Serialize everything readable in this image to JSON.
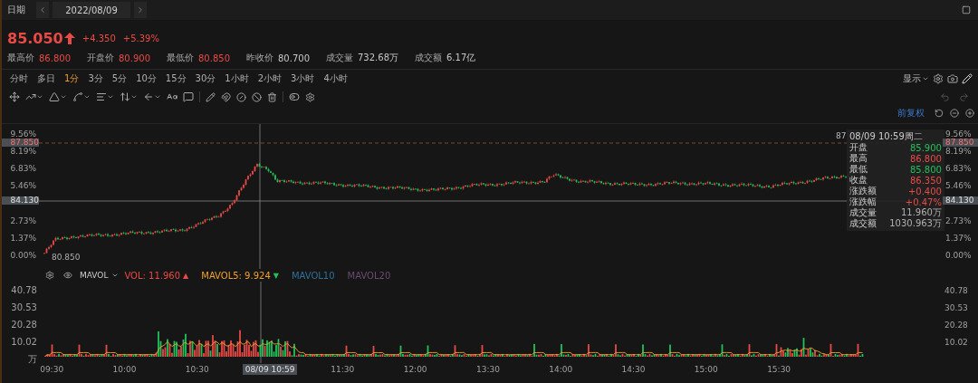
{
  "date_bar": {
    "label": "日期",
    "date": "2022/08/09"
  },
  "quote": {
    "price": "85.050",
    "change": "+4.350",
    "change_pct": "+5.39%",
    "stats": [
      {
        "label": "最高价",
        "value": "86.800",
        "color": "#e84a46"
      },
      {
        "label": "开盘价",
        "value": "80.900",
        "color": "#e84a46"
      },
      {
        "label": "最低价",
        "value": "80.850",
        "color": "#e84a46"
      },
      {
        "label": "昨收价",
        "value": "80.700",
        "color": "#c8c8c8"
      },
      {
        "label": "成交量",
        "value": "732.68万",
        "color": "#c8c8c8"
      },
      {
        "label": "成交额",
        "value": "6.17亿",
        "color": "#c8c8c8"
      }
    ]
  },
  "periods": [
    {
      "label": "分时",
      "selected": false
    },
    {
      "label": "多日",
      "selected": false
    },
    {
      "label": "1分",
      "selected": true
    },
    {
      "label": "3分",
      "selected": false
    },
    {
      "label": "5分",
      "selected": false
    },
    {
      "label": "10分",
      "selected": false
    },
    {
      "label": "15分",
      "selected": false
    },
    {
      "label": "30分",
      "selected": false
    },
    {
      "label": "1小时",
      "selected": false
    },
    {
      "label": "2小时",
      "selected": false
    },
    {
      "label": "3小时",
      "selected": false
    },
    {
      "label": "4小时",
      "selected": false
    }
  ],
  "display_menu": {
    "label": "显示"
  },
  "adjust": {
    "label": "前复权"
  },
  "price_axis": {
    "ticks": [
      "9.56%",
      "8.19%",
      "6.83%",
      "5.46%",
      "2.73%",
      "1.37%",
      "0.00%"
    ],
    "high_tag": "87.850",
    "crosshair_tag": "84.130"
  },
  "right_price_axis": {
    "ticks": [
      "9.56%",
      "8.19%",
      "6.83%",
      "5.46%",
      "2.73%",
      "1.37%",
      "0.00%"
    ],
    "high_tag": "87.850",
    "crosshair_tag": "84.130"
  },
  "low_label": "80.850",
  "high_label": "87",
  "tooltip": {
    "title": "08/09 10:59周二",
    "rows": [
      {
        "label": "开盘",
        "value": "85.900",
        "color": "#22c05a"
      },
      {
        "label": "最高",
        "value": "86.800",
        "color": "#e84a46"
      },
      {
        "label": "最低",
        "value": "85.800",
        "color": "#22c05a"
      },
      {
        "label": "收盘",
        "value": "86.350",
        "color": "#e84a46"
      },
      {
        "label": "涨跌额",
        "value": "+0.400",
        "color": "#e84a46"
      },
      {
        "label": "涨跌幅",
        "value": "+0.47%",
        "color": "#e84a46"
      },
      {
        "label": "成交量",
        "value": "11.960万",
        "color": "#b0b0b0"
      },
      {
        "label": "成交额",
        "value": "1030.963万",
        "color": "#b0b0b0"
      }
    ]
  },
  "volume": {
    "indicator": "MAVOL",
    "legend": [
      {
        "label": "VOL:",
        "value": "11.960",
        "arrow": {
          "text": "▲",
          "color": "#e84a46"
        },
        "color": "#e84a46"
      },
      {
        "label": "MAVOL5:",
        "value": "9.924",
        "arrow": {
          "text": "▼",
          "color": "#22c05a"
        },
        "color": "#f0a030"
      },
      {
        "label": "MAVOL10",
        "color": "#2f6f9a"
      },
      {
        "label": "MAVOL20",
        "color": "#6a4a70"
      }
    ],
    "ticks": [
      "40.78",
      "30.53",
      "20.28",
      "10.02",
      "万"
    ],
    "right_ticks": [
      "40.78",
      "30.53",
      "20.28",
      "10.02"
    ]
  },
  "time_axis": {
    "labels": [
      {
        "kind": "time",
        "text": "09:30"
      },
      {
        "kind": "time",
        "text": "10:00"
      },
      {
        "kind": "time",
        "text": "10:30"
      },
      {
        "kind": "crosshair",
        "text": "08/09 10:59"
      },
      {
        "kind": "time",
        "text": "11:30"
      },
      {
        "kind": "time",
        "text": "12:00"
      },
      {
        "kind": "time",
        "text": "13:30"
      },
      {
        "kind": "time",
        "text": "14:00"
      },
      {
        "kind": "time",
        "text": "14:30"
      },
      {
        "kind": "time",
        "text": "15:00"
      },
      {
        "kind": "time",
        "text": "15:30"
      }
    ]
  }
}
